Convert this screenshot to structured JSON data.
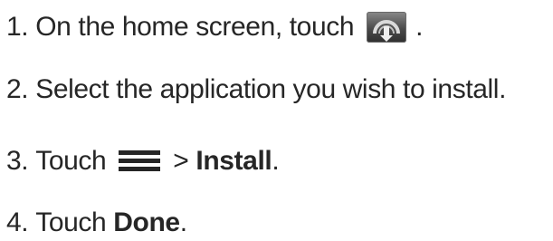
{
  "steps": [
    {
      "number": "1.",
      "text": "On the home screen, touch",
      "icon": "installer-app-icon",
      "after": "."
    },
    {
      "number": "2.",
      "text": "Select the application you wish to install."
    },
    {
      "number": "3.",
      "text": "Touch",
      "icon": "menu-icon",
      "separator": ">",
      "bold": "Install",
      "after": "."
    },
    {
      "number": "4.",
      "text": "Touch",
      "bold": "Done",
      "after": "."
    }
  ]
}
